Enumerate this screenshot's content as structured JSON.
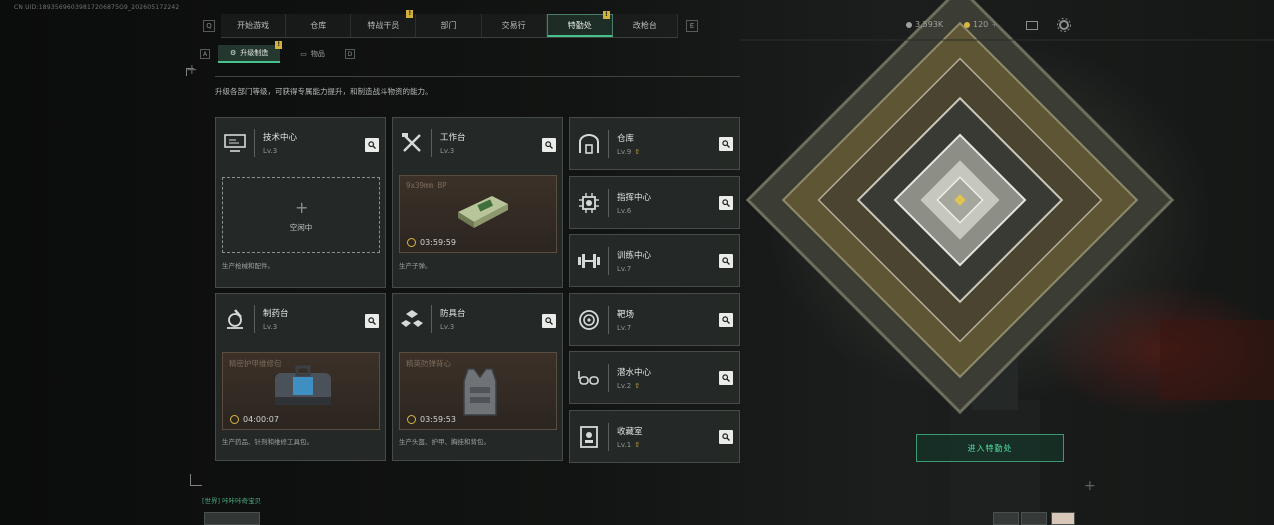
{
  "uid": "CN UID:18935696039817206875G9_202605172242",
  "nav": {
    "tabs": [
      {
        "label": "开始游戏",
        "badge": ""
      },
      {
        "label": "仓库",
        "badge": ""
      },
      {
        "label": "特战干员",
        "badge": "!"
      },
      {
        "label": "部门",
        "badge": ""
      },
      {
        "label": "交易行",
        "badge": ""
      },
      {
        "label": "特勤处",
        "badge": "!",
        "active": true
      },
      {
        "label": "改枪台",
        "badge": ""
      }
    ],
    "left_key": "Q",
    "right_key": "E"
  },
  "currency": {
    "coins": "3,593K",
    "tickets": "120"
  },
  "subnav": {
    "tabs": [
      {
        "label": "升级制造",
        "active": true,
        "badge": "!"
      },
      {
        "label": "物品",
        "active": false,
        "badge": ""
      }
    ],
    "left_key": "A",
    "right_key": "D"
  },
  "description": "升级各部门等级，可获得专属能力提升，和制造战斗物资的能力。",
  "workstations": [
    {
      "name": "技术中心",
      "level": "Lv.3",
      "icon": "monitor-icon",
      "status": "idle",
      "idle_label": "空闲中",
      "caption": "生产枪械和配件。"
    },
    {
      "name": "工作台",
      "level": "Lv.3",
      "icon": "tools-icon",
      "status": "producing",
      "product": "9x39mm BP",
      "timer": "03:59:59",
      "caption": "生产子弹。"
    },
    {
      "name": "制药台",
      "level": "Lv.3",
      "icon": "microscope-icon",
      "status": "producing",
      "product": "精密护甲维修包",
      "timer": "04:00:07",
      "caption": "生产药品、针剂和维修工具包。"
    },
    {
      "name": "防具台",
      "level": "Lv.3",
      "icon": "armor-parts-icon",
      "status": "producing",
      "product": "精英防弹背心",
      "timer": "03:59:53",
      "caption": "生产头盔、护甲、胸挂和背包。"
    }
  ],
  "facilities": [
    {
      "name": "仓库",
      "level": "Lv.9",
      "upgrade": true,
      "icon": "warehouse-icon"
    },
    {
      "name": "指挥中心",
      "level": "Lv.6",
      "upgrade": false,
      "icon": "chip-icon"
    },
    {
      "name": "训练中心",
      "level": "Lv.7",
      "upgrade": false,
      "icon": "dumbbell-icon"
    },
    {
      "name": "靶场",
      "level": "Lv.7",
      "upgrade": false,
      "icon": "target-icon"
    },
    {
      "name": "潜水中心",
      "level": "Lv.2",
      "upgrade": true,
      "icon": "diving-mask-icon"
    },
    {
      "name": "收藏室",
      "level": "Lv.1",
      "upgrade": true,
      "icon": "collection-icon"
    }
  ],
  "enter_button": "进入特勤处",
  "chat": "[世界] 咔咔咔奇宝贝"
}
